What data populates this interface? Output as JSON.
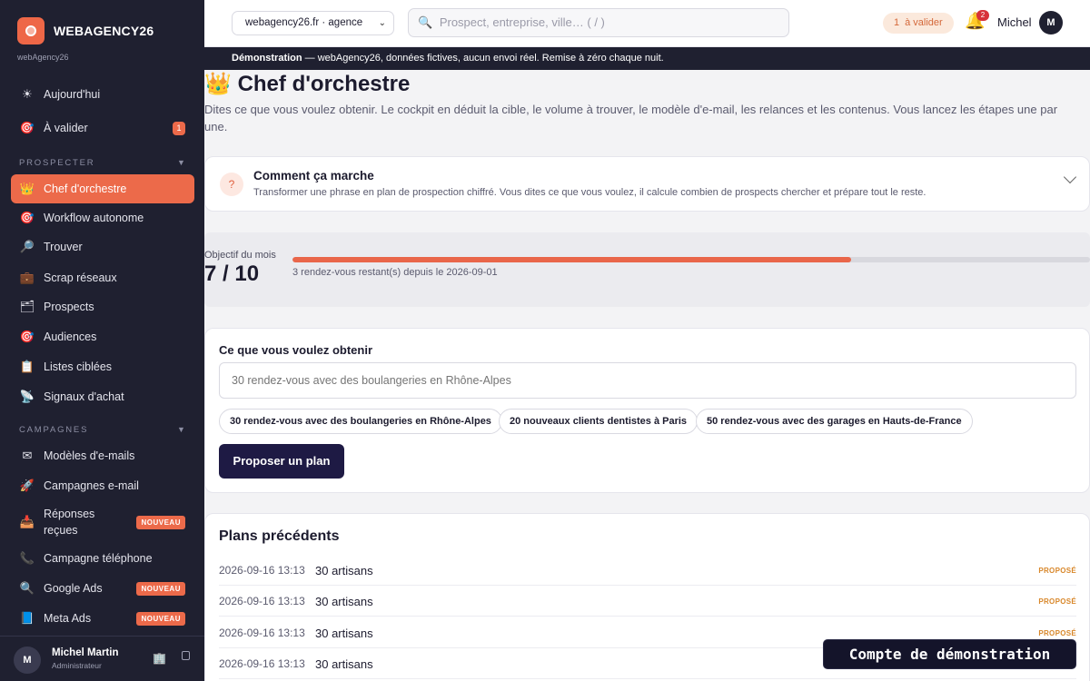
{
  "brand": {
    "name": "WEBAGENCY26",
    "sub": "webAgency26"
  },
  "sidebar": {
    "top_items": [
      {
        "icon": "☀",
        "label": "Aujourd'hui"
      },
      {
        "icon": "🎯",
        "label": "À valider",
        "count": "1"
      }
    ],
    "section_prospecter": "PROSPECTER",
    "prospecter_items": [
      {
        "icon": "👑",
        "label": "Chef d'orchestre"
      },
      {
        "icon": "🎯",
        "label": "Workflow autonome"
      },
      {
        "icon": "🔎",
        "label": "Trouver"
      },
      {
        "icon": "💼",
        "label": "Scrap réseaux"
      },
      {
        "icon": "🗂",
        "label": "Prospects"
      },
      {
        "icon": "🎯",
        "label": "Audiences"
      },
      {
        "icon": "📋",
        "label": "Listes ciblées"
      },
      {
        "icon": "📡",
        "label": "Signaux d'achat"
      }
    ],
    "section_campagnes": "CAMPAGNES",
    "campagnes_items": [
      {
        "icon": "✉",
        "label": "Modèles d'e-mails"
      },
      {
        "icon": "🚀",
        "label": "Campagnes e-mail"
      },
      {
        "icon": "📥",
        "label": "Réponses reçues",
        "badge": "NOUVEAU"
      },
      {
        "icon": "📞",
        "label": "Campagne téléphone"
      },
      {
        "icon": "🔍",
        "label": "Google Ads",
        "badge": "NOUVEAU"
      },
      {
        "icon": "📘",
        "label": "Meta Ads",
        "badge": "NOUVEAU"
      }
    ],
    "user": {
      "initial": "M",
      "name": "Michel Martin",
      "role": "Administrateur"
    }
  },
  "topbar": {
    "agency_select": "webagency26.fr · agence",
    "search_placeholder": "Prospect, entreprise, ville…  ( / )",
    "validate_count": "1",
    "validate_label": "à valider",
    "notif_count": "2",
    "user_name": "Michel",
    "user_initial": "M"
  },
  "banner": {
    "strong": "Démonstration",
    "text": " — webAgency26, données fictives, aucun envoi réel. Remise à zéro chaque nuit."
  },
  "main": {
    "title_icon": "👑",
    "title": "Chef d'orchestre",
    "description": "Dites ce que vous voulez obtenir. Le cockpit en déduit la cible, le volume à trouver, le modèle d'e-mail, les relances et les contenus. Vous lancez les étapes une par une.",
    "how": {
      "icon": "?",
      "title": "Comment ça marche",
      "subtitle": "Transformer une phrase en plan de prospection chiffré. Vous dites ce que vous voulez, il calcule combien de prospects chercher et prépare tout le reste."
    },
    "goal": {
      "label": "Objectif du mois",
      "value": "7 / 10",
      "progress": 0.7,
      "note": "3 rendez-vous restant(s) depuis le 2026-09-01"
    },
    "want": {
      "title": "Ce que vous voulez obtenir",
      "placeholder": "30 rendez-vous avec des boulangeries en Rhône-Alpes",
      "chips": [
        "30 rendez-vous avec des boulangeries en Rhône-Alpes",
        "20 nouveaux clients dentistes à Paris",
        "50 rendez-vous avec des garages en Hauts-de-France"
      ],
      "button": "Proposer un plan"
    },
    "plans": {
      "title": "Plans précédents",
      "rows": [
        {
          "date": "2026-09-16 13:13",
          "name": "30 artisans",
          "status": "PROPOSÉ"
        },
        {
          "date": "2026-09-16 13:13",
          "name": "30 artisans",
          "status": "PROPOSÉ"
        },
        {
          "date": "2026-09-16 13:13",
          "name": "30 artisans",
          "status": "PROPOSÉ"
        },
        {
          "date": "2026-09-16 13:13",
          "name": "30 artisans",
          "status": ""
        }
      ]
    }
  },
  "demo_tag": "Compte de démonstration",
  "colors": {
    "accent": "#ec6a4a",
    "sidebar": "#1f2030",
    "primary_button": "#1e1a44"
  }
}
